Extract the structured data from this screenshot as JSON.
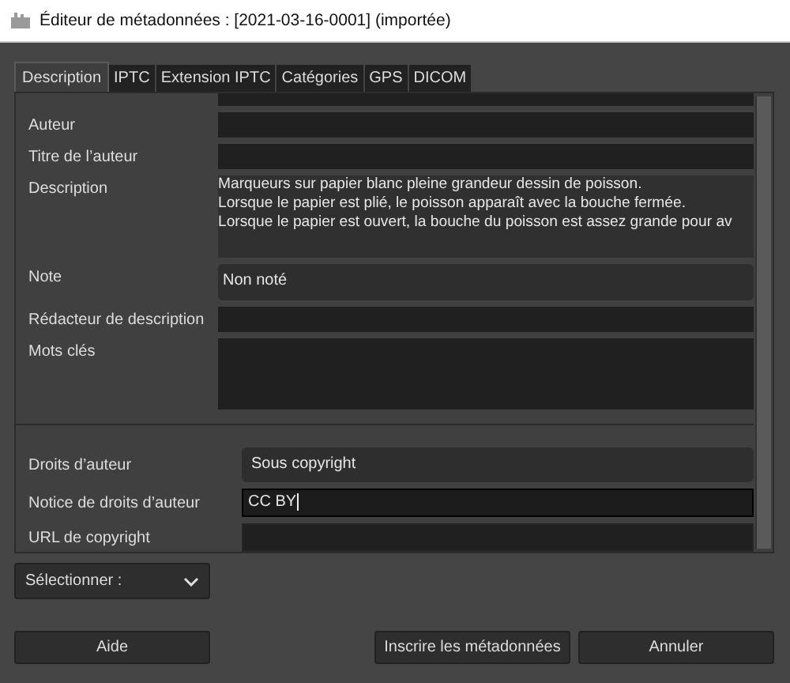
{
  "window": {
    "title": "Éditeur de métadonnées : [2021-03-16-0001] (importée)"
  },
  "tabs": [
    {
      "label": "Description",
      "selected": true
    },
    {
      "label": "IPTC",
      "selected": false
    },
    {
      "label": "Extension IPTC",
      "selected": false
    },
    {
      "label": "Catégories",
      "selected": false
    },
    {
      "label": "GPS",
      "selected": false
    },
    {
      "label": "DICOM",
      "selected": false
    }
  ],
  "fields": [
    {
      "kind": "cut"
    },
    {
      "kind": "text",
      "label": "Auteur"
    },
    {
      "kind": "text",
      "label": "Titre de l’auteur"
    },
    {
      "kind": "area",
      "label": "Description",
      "lines": [
        "Marqueurs sur papier blanc pleine grandeur dessin de poisson.",
        "Lorsque le papier est plié, le poisson apparaît avec la bouche fermée.",
        "Lorsque le papier est ouvert, la bouche du poisson est assez grande pour av"
      ]
    },
    {
      "kind": "combo",
      "label": "Note",
      "value": "Non noté"
    },
    {
      "kind": "text",
      "label": "Rédacteur de description"
    },
    {
      "kind": "area",
      "label": "Mots clés"
    }
  ],
  "copyright": [
    {
      "kind": "combo",
      "label": "Droits d’auteur",
      "value": "Sous copyright"
    },
    {
      "kind": "text",
      "label": "Notice de droits d’auteur",
      "value": "CC BY",
      "focused": true
    },
    {
      "kind": "text",
      "label": "URL de copyright",
      "focused": false
    }
  ],
  "selector": {
    "label": "Sélectionner :"
  },
  "buttons": {
    "help": "Aide",
    "write": "Inscrire les métadonnées",
    "cancel": "Annuler"
  }
}
